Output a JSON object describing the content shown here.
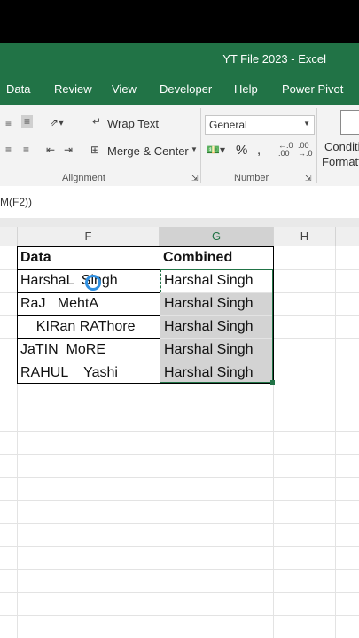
{
  "window": {
    "title": "YT File 2023  -  Excel"
  },
  "menu": {
    "items": [
      "Data",
      "Review",
      "View",
      "Developer",
      "Help",
      "Power Pivot"
    ]
  },
  "ribbon": {
    "wrap_text": "Wrap Text",
    "merge_center": "Merge & Center",
    "number_format": "General",
    "conditional_line1": "Conditi",
    "conditional_line2": "Formatt",
    "groups": {
      "alignment": "Alignment",
      "number": "Number"
    }
  },
  "formula_bar": {
    "visible_text": "M(F2))"
  },
  "columns": [
    "F",
    "G",
    "H"
  ],
  "sheet": {
    "header_data": "Data",
    "header_combined": "Combined",
    "rows": [
      {
        "data": "HarshaL  Singh",
        "combined": "Harshal Singh"
      },
      {
        "data": "RaJ   MehtA",
        "combined": "Harshal Singh"
      },
      {
        "data": "    KIRan RAThore",
        "combined": "Harshal Singh"
      },
      {
        "data": "JaTIN  MoRE",
        "combined": "Harshal Singh"
      },
      {
        "data": "RAHUL    Yashi",
        "combined": "Harshal Singh"
      }
    ]
  },
  "colors": {
    "excel_green": "#217346",
    "selection_gray": "#d3d3d3",
    "cursor_blue": "#2f8fe0"
  }
}
